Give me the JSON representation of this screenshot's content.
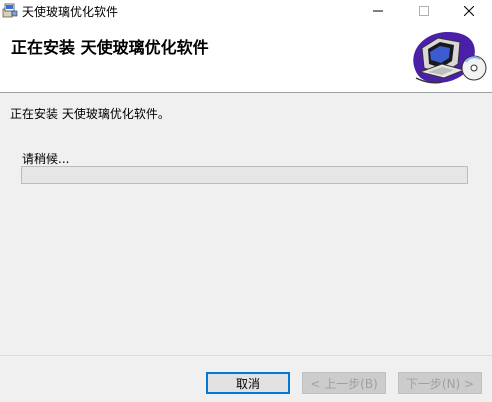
{
  "window": {
    "title": "天使玻璃优化软件",
    "icons": {
      "app": "installer-icon",
      "minimize": "minimize-icon",
      "maximize": "maximize-icon",
      "close": "close-icon"
    }
  },
  "header": {
    "title": "正在安装 天使玻璃优化软件",
    "art": "computer-setup-icon"
  },
  "body": {
    "status": "正在安装 天使玻璃优化软件。",
    "wait_label": "请稍候...",
    "progress": 0
  },
  "buttons": {
    "cancel": "取消",
    "back": "< 上一步(B)",
    "next": "下一步(N) >"
  },
  "colors": {
    "accent": "#0078d7",
    "progress_fill": "#06b025"
  }
}
